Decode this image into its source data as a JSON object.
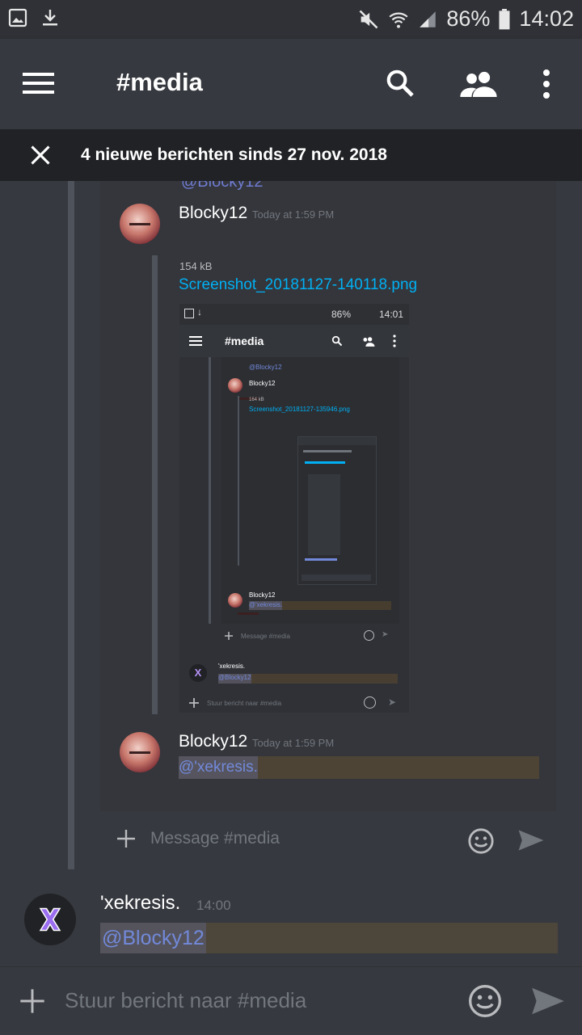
{
  "status_bar": {
    "battery": "86%",
    "time": "14:02"
  },
  "header": {
    "channel": "#media"
  },
  "banner": {
    "text": "4 nieuwe berichten sinds 27 nov. 2018"
  },
  "embed": {
    "partial_mention": "@Blocky12",
    "message1": {
      "username": "Blocky12",
      "timestamp": "Today at 1:59 PM"
    },
    "attachment": {
      "size": "154 kB",
      "filename": "Screenshot_20181127-140118.png"
    },
    "inner": {
      "battery": "86%",
      "time": "14:01",
      "channel": "#media",
      "mention1": "@Blocky12",
      "username1": "Blocky12",
      "size": "164 kB",
      "filename": "Screenshot_20181127-135946.png",
      "username2": "Blocky12",
      "mention2": "@'xekresis.",
      "placeholder1": "Message #media",
      "username3": "'xekresis.",
      "mention3": "@Blocky12",
      "placeholder2": "Stuur bericht naar #media"
    },
    "message2": {
      "username": "Blocky12",
      "timestamp": "Today at 1:59 PM",
      "mention": "@'xekresis."
    },
    "composer_placeholder": "Message #media"
  },
  "message": {
    "username": "'xekresis.",
    "timestamp": "14:00",
    "mention": "@Blocky12"
  },
  "composer": {
    "placeholder": "Stuur bericht naar #media"
  },
  "colors": {
    "background": "#36393f",
    "link": "#00b0f4",
    "mention": "#7289da",
    "highlight": "#faa61a"
  }
}
